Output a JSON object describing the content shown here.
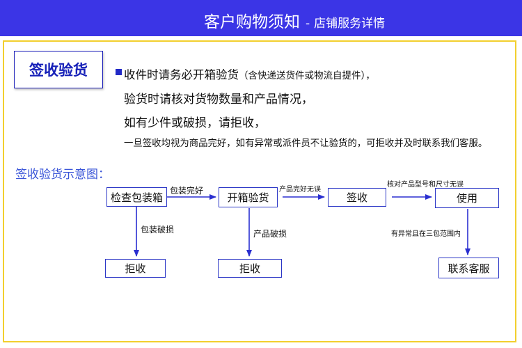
{
  "header": {
    "title": "客户购物须知",
    "separator": "-",
    "subtitle": "店铺服务详情"
  },
  "section": {
    "title": "签收验货",
    "notes": {
      "line1_main": "收件时请务必开箱验货",
      "line1_paren": "（含快递送货件或物流自提件），",
      "line2": "验货时请核对货物数量和产品情况，",
      "line3": "如有少件或破损，请拒收，",
      "line4": "一旦签收均视为商品完好，如有异常或派件员不让验货的，可拒收并及时联系我们客服。"
    }
  },
  "diagram": {
    "title": "签收验货示意图：",
    "nodes": {
      "inspect_box": "检查包装箱",
      "open_inspect": "开箱验货",
      "sign": "签收",
      "use": "使用",
      "reject1": "拒收",
      "reject2": "拒收",
      "contact": "联系客服"
    },
    "edges": {
      "package_ok": "包装完好",
      "product_ok": "产品完好无误",
      "check_model": "核对产品型号和尺寸无误",
      "package_damaged": "包装破损",
      "product_damaged": "产品破损",
      "issue_within_warranty": "有异常且在三包范围内"
    },
    "colors": {
      "arrow": "#2a2fd0",
      "node_border": "#2b36c6"
    }
  }
}
